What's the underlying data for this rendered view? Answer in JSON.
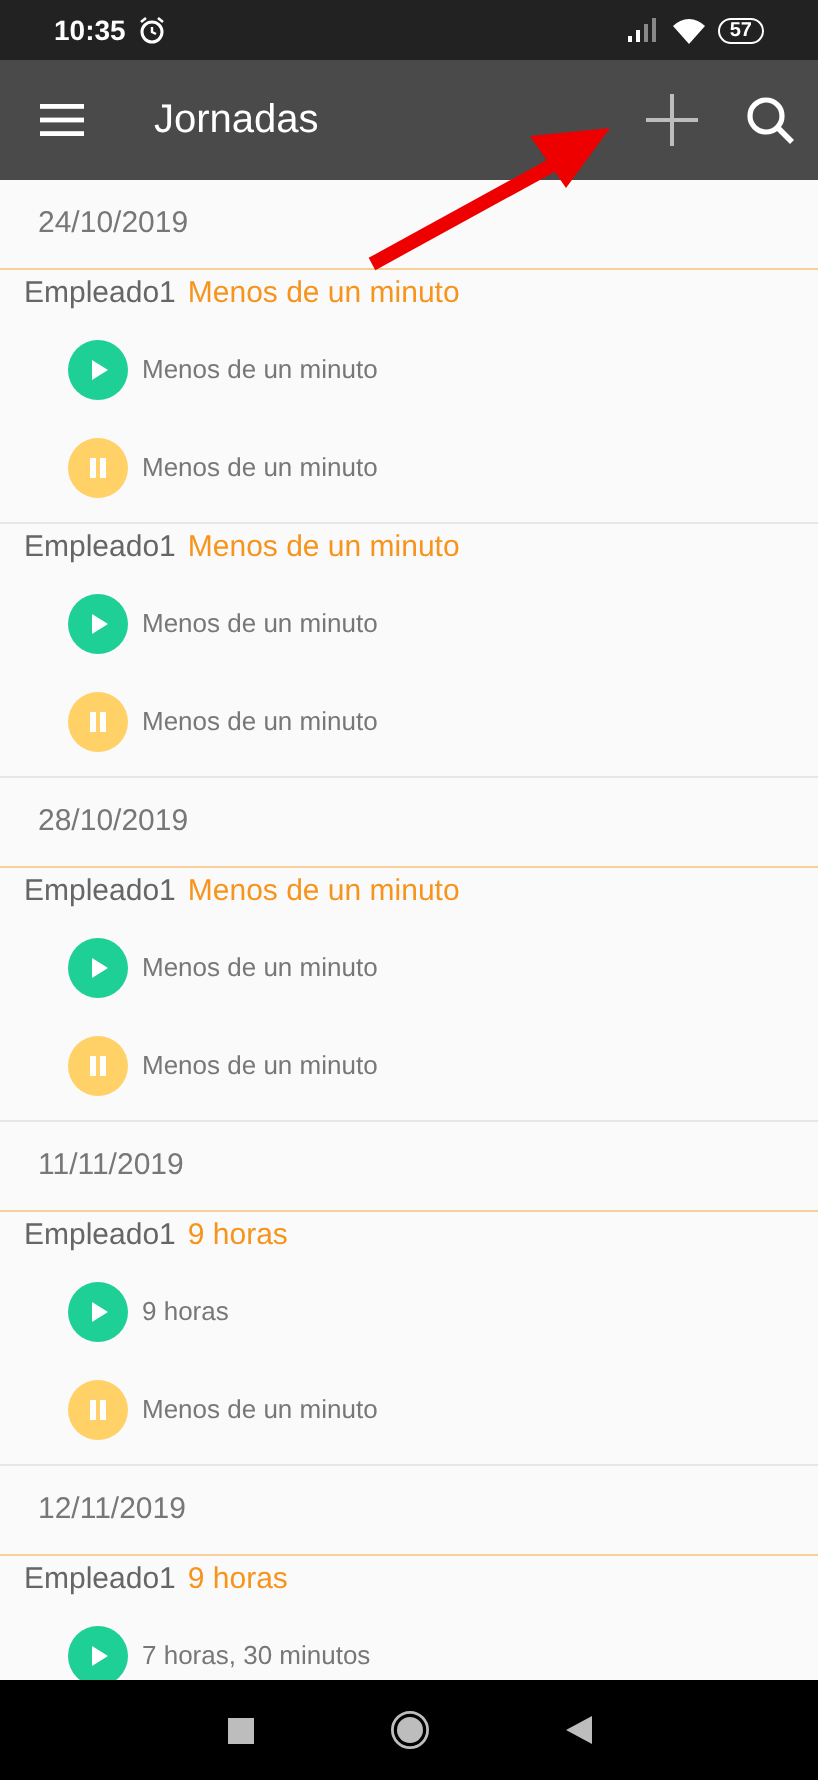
{
  "status_bar": {
    "time": "10:35",
    "battery": "57"
  },
  "app_bar": {
    "title": "Jornadas"
  },
  "sections": [
    {
      "date": "24/10/2019",
      "groups": [
        {
          "employee": "Empleado1",
          "total": "Menos de un minuto",
          "entries": [
            {
              "kind": "start",
              "text": "Menos de un minuto"
            },
            {
              "kind": "pause",
              "text": "Menos de un minuto"
            }
          ]
        },
        {
          "employee": "Empleado1",
          "total": "Menos de un minuto",
          "entries": [
            {
              "kind": "start",
              "text": "Menos de un minuto"
            },
            {
              "kind": "pause",
              "text": "Menos de un minuto"
            }
          ]
        }
      ]
    },
    {
      "date": "28/10/2019",
      "groups": [
        {
          "employee": "Empleado1",
          "total": "Menos de un minuto",
          "entries": [
            {
              "kind": "start",
              "text": "Menos de un minuto"
            },
            {
              "kind": "pause",
              "text": "Menos de un minuto"
            }
          ]
        }
      ]
    },
    {
      "date": "11/11/2019",
      "groups": [
        {
          "employee": "Empleado1",
          "total": "9 horas",
          "entries": [
            {
              "kind": "start",
              "text": "9 horas"
            },
            {
              "kind": "pause",
              "text": "Menos de un minuto"
            }
          ]
        }
      ]
    },
    {
      "date": "12/11/2019",
      "groups": [
        {
          "employee": "Empleado1",
          "total": "9 horas",
          "entries": [
            {
              "kind": "start",
              "text": "7 horas, 30 minutos"
            }
          ]
        }
      ]
    }
  ]
}
